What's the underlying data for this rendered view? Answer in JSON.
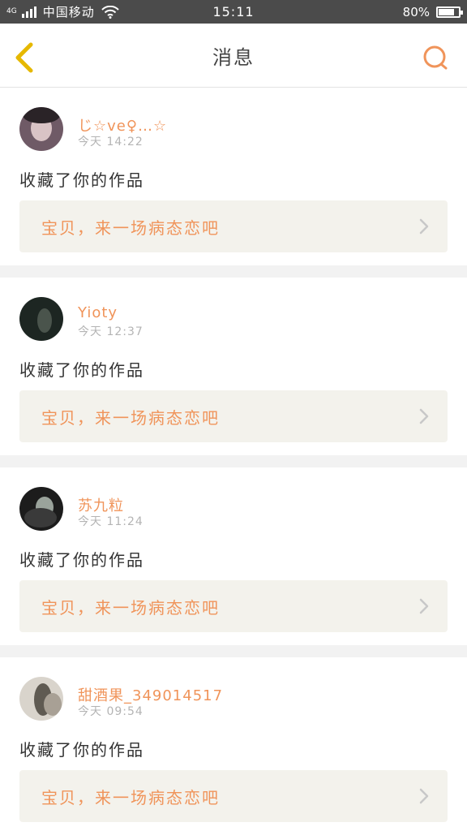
{
  "status_bar": {
    "network_type": "4G",
    "carrier": "中国移动",
    "time": "15:11",
    "battery_percent": "80%",
    "battery_level": 0.8
  },
  "header": {
    "title": "消息",
    "back_icon": "chevron-left-icon",
    "search_icon": "search-icon"
  },
  "colors": {
    "accent": "#f0945a",
    "back_icon": "#e6b800",
    "card_bg": "#f3f2ec",
    "status_bar": "#4b4b4b"
  },
  "messages": [
    {
      "username": "じ☆ve♀…☆",
      "time": "今天 14:22",
      "action": "收藏了你的作品",
      "work_title": "宝贝，来一场病态恋吧"
    },
    {
      "username": "Yioty",
      "time": "今天 12:37",
      "action": "收藏了你的作品",
      "work_title": "宝贝，来一场病态恋吧"
    },
    {
      "username": "苏九粒",
      "time": "今天 11:24",
      "action": "收藏了你的作品",
      "work_title": "宝贝，来一场病态恋吧"
    },
    {
      "username": "甜酒果_349014517",
      "time": "今天 09:54",
      "action": "收藏了你的作品",
      "work_title": "宝贝，来一场病态恋吧"
    }
  ]
}
